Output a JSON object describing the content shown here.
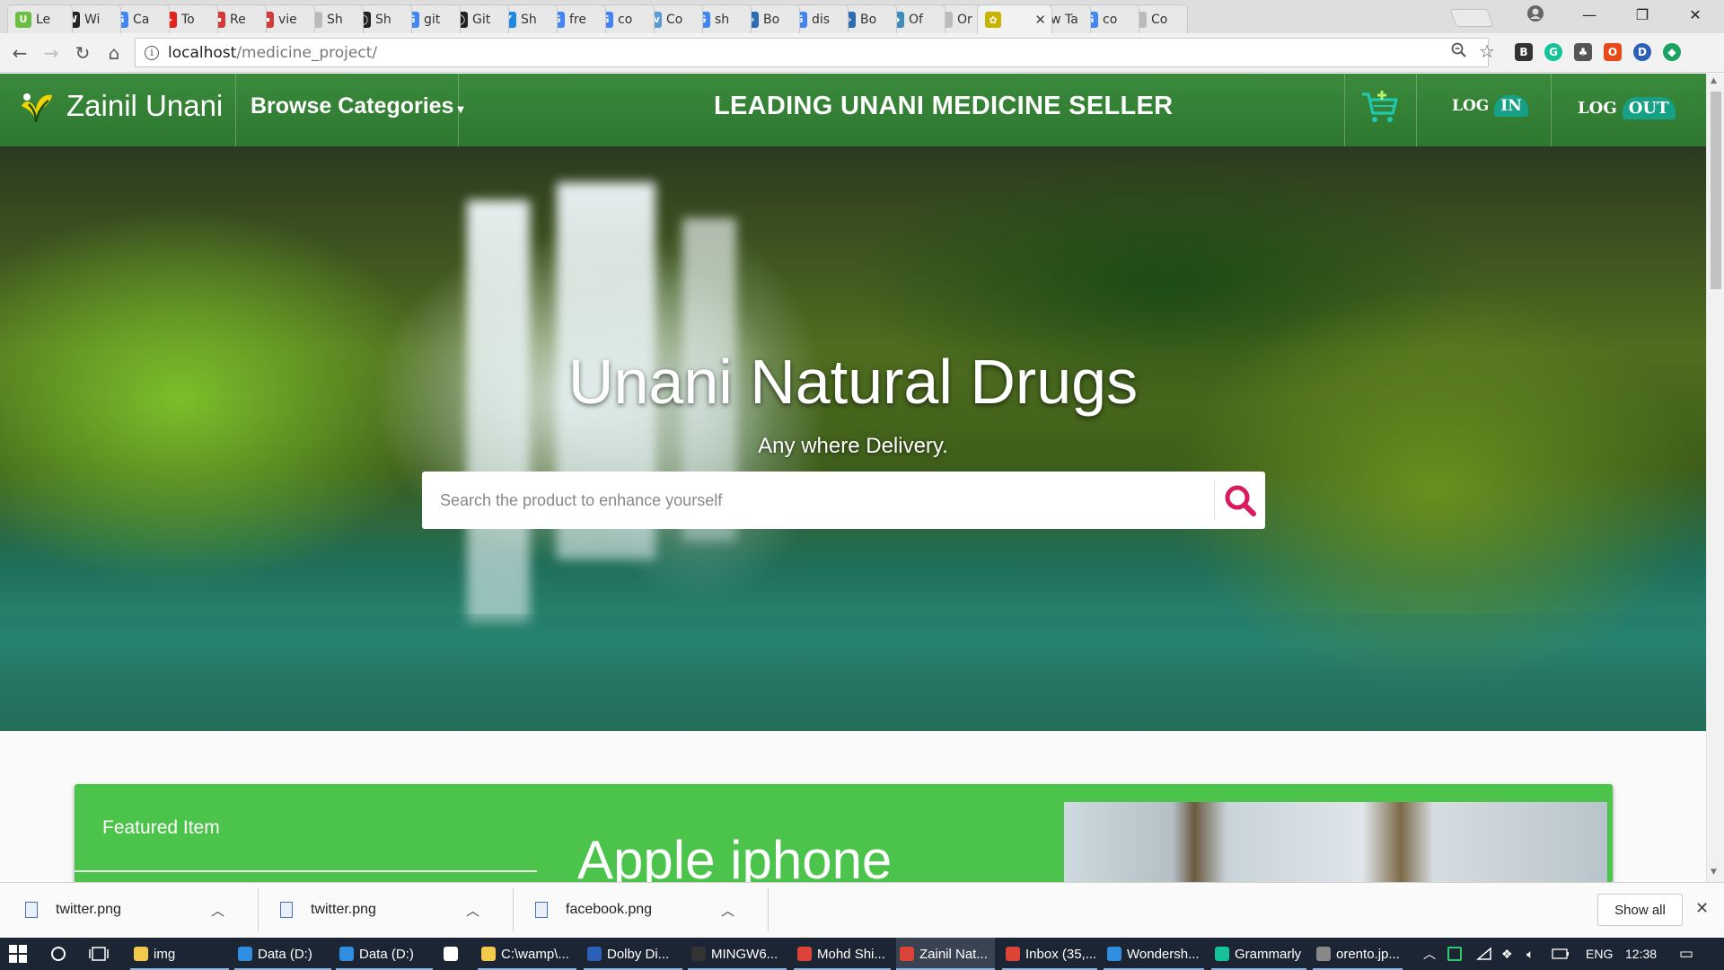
{
  "browser": {
    "tabs": [
      {
        "label": "Le",
        "icon_color": "#6abf40",
        "glyph": "U"
      },
      {
        "label": "Wi",
        "icon_color": "#222222",
        "glyph": "W"
      },
      {
        "label": "Ca",
        "icon_color": "#4285f4",
        "glyph": "G"
      },
      {
        "label": "To",
        "icon_color": "#e62117",
        "glyph": "▶"
      },
      {
        "label": "Re",
        "icon_color": "#d43a3a",
        "glyph": "▬"
      },
      {
        "label": "vie",
        "icon_color": "#d43a3a",
        "glyph": "▬"
      },
      {
        "label": "Sh",
        "icon_color": "#bbbbbb",
        "glyph": ""
      },
      {
        "label": "Sh",
        "icon_color": "#222222",
        "glyph": "◯"
      },
      {
        "label": "git",
        "icon_color": "#4285f4",
        "glyph": "G"
      },
      {
        "label": "Git",
        "icon_color": "#222222",
        "glyph": "◯"
      },
      {
        "label": "Sh",
        "icon_color": "#1e88e5",
        "glyph": "Y"
      },
      {
        "label": "fre",
        "icon_color": "#4285f4",
        "glyph": "G"
      },
      {
        "label": "co",
        "icon_color": "#4285f4",
        "glyph": "G"
      },
      {
        "label": "Co",
        "icon_color": "#5b9bd5",
        "glyph": "cv"
      },
      {
        "label": "sh",
        "icon_color": "#4285f4",
        "glyph": "G"
      },
      {
        "label": "Bo",
        "icon_color": "#2d6db5",
        "glyph": "‹›"
      },
      {
        "label": "dis",
        "icon_color": "#4285f4",
        "glyph": "G"
      },
      {
        "label": "Bo",
        "icon_color": "#2d6db5",
        "glyph": "‹›"
      },
      {
        "label": "Of",
        "icon_color": "#3c8dbc",
        "glyph": "◆"
      },
      {
        "label": "Or",
        "icon_color": "#bbbbbb",
        "glyph": ""
      },
      {
        "label": "",
        "icon_color": "#c8b400",
        "glyph": "✿"
      },
      {
        "label": "New Ta",
        "icon_color": "",
        "glyph": ""
      },
      {
        "label": "co",
        "icon_color": "#4285f4",
        "glyph": "G"
      },
      {
        "label": "Co",
        "icon_color": "#bbbbbb",
        "glyph": ""
      }
    ],
    "active_tab_index": 20,
    "window_controls": [
      "—",
      "❐",
      "✕"
    ],
    "address": {
      "host": "localhost",
      "path": "/medicine_project/"
    },
    "extensions": [
      {
        "glyph": "B",
        "color": "#333333"
      },
      {
        "glyph": "G",
        "color": "#15c39a"
      },
      {
        "glyph": "♣",
        "color": "#555555"
      },
      {
        "glyph": "O",
        "color": "#e64a19"
      },
      {
        "glyph": "D",
        "color": "#2b5fb8"
      },
      {
        "glyph": "◆",
        "color": "#1aa260"
      }
    ]
  },
  "site": {
    "brand": "Zainil Unani",
    "browse": "Browse Categories",
    "tagline": "LEADING UNANI MEDICINE SELLER",
    "login_a": "LOG",
    "login_b": "IN",
    "logout_a": "LOG",
    "logout_b": "OUT",
    "hero_title": "Unani Natural Drugs",
    "hero_subtitle": "Any where Delivery.",
    "search_placeholder": "Search the product to enhance yourself",
    "featured_label": "Featured Item",
    "featured_name": "Apple iphone"
  },
  "downloads": {
    "items": [
      "twitter.png",
      "twitter.png",
      "facebook.png"
    ],
    "show_all": "Show all"
  },
  "taskbar": {
    "items": [
      {
        "label": "img",
        "color": "#f2c94c"
      },
      {
        "label": "Data (D:)",
        "color": "#2f8ee0"
      },
      {
        "label": "Data (D:)",
        "color": "#2f8ee0"
      },
      {
        "label": "",
        "color": "#ffffff"
      },
      {
        "label": "C:\\wamp\\...",
        "color": "#f2c94c"
      },
      {
        "label": "Dolby Di...",
        "color": "#2b5fb8"
      },
      {
        "label": "MINGW6...",
        "color": "#333333"
      },
      {
        "label": "Mohd Shi...",
        "color": "#db4437"
      },
      {
        "label": "Zainil Nat...",
        "color": "#db4437"
      },
      {
        "label": "Inbox (35,...",
        "color": "#db4437"
      },
      {
        "label": "Wondersh...",
        "color": "#2f8ee0"
      },
      {
        "label": "Grammarly",
        "color": "#15c39a"
      },
      {
        "label": "orento.jp...",
        "color": "#888888"
      }
    ],
    "language": "ENG",
    "time": "12:38"
  },
  "colors": {
    "navbar": "#2f7d32",
    "featured": "#4cc44c",
    "search_icon": "#d81b60"
  }
}
